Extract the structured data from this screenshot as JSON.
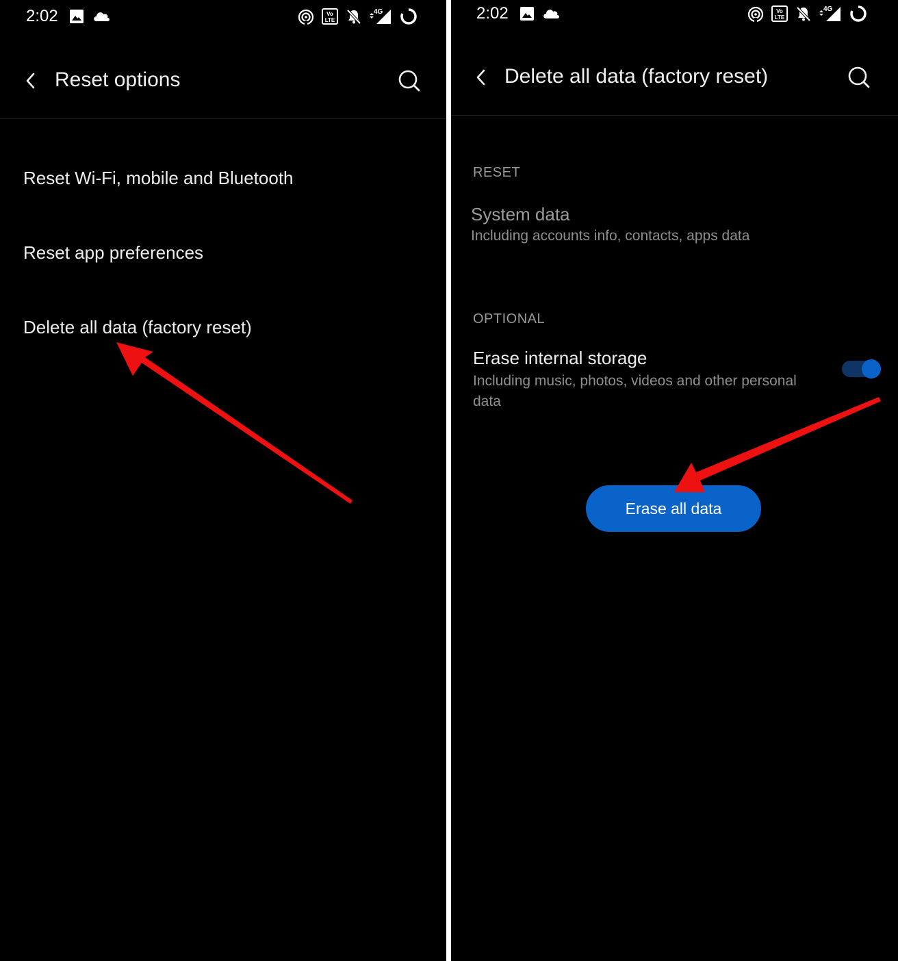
{
  "colors": {
    "accent": "#0a63c9",
    "annotation": "#ee1111",
    "toggle_track": "#0e3566",
    "background": "#000000",
    "divider": "#ffffff"
  },
  "left_screen": {
    "status_bar": {
      "time": "2:02",
      "left_icons": [
        "image-icon",
        "cloud-icon"
      ],
      "right_icons": [
        "hotspot-icon",
        "volte-icon",
        "bell-off-icon",
        "signal-4g-icon",
        "battery-ring-icon"
      ]
    },
    "app_bar": {
      "title": "Reset options",
      "back_icon": "back-arrow-icon",
      "search_icon": "search-icon"
    },
    "items": [
      {
        "label": "Reset Wi-Fi, mobile and Bluetooth"
      },
      {
        "label": "Reset app preferences"
      },
      {
        "label": "Delete all data (factory reset)"
      }
    ]
  },
  "right_screen": {
    "status_bar": {
      "time": "2:02",
      "left_icons": [
        "image-icon",
        "cloud-icon"
      ],
      "right_icons": [
        "hotspot-icon",
        "volte-icon",
        "bell-off-icon",
        "signal-4g-icon",
        "battery-ring-icon"
      ]
    },
    "app_bar": {
      "title": "Delete all data (factory reset)",
      "back_icon": "back-arrow-icon",
      "search_icon": "search-icon"
    },
    "reset_section": {
      "header": "RESET",
      "title": "System data",
      "summary": "Including accounts info, contacts, apps data"
    },
    "optional_section": {
      "header": "OPTIONAL",
      "title": "Erase internal storage",
      "summary": "Including music, photos, videos and other personal data",
      "toggle_on": true
    },
    "action_button": {
      "label": "Erase all data"
    }
  }
}
